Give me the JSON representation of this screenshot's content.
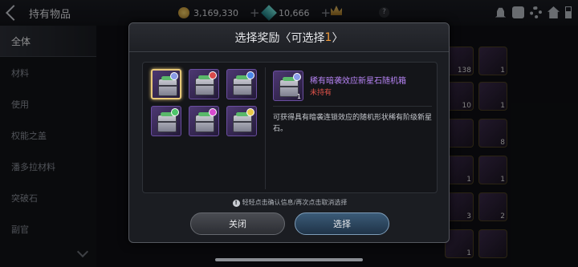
{
  "header": {
    "title": "持有物品",
    "gold": "3,169,330",
    "crystal": "10,666"
  },
  "sidebar": {
    "items": [
      {
        "label": "全体"
      },
      {
        "label": "材料"
      },
      {
        "label": "使用"
      },
      {
        "label": "权能之盖"
      },
      {
        "label": "潘多拉材料"
      },
      {
        "label": "突破石"
      },
      {
        "label": "副官"
      }
    ]
  },
  "background_counts": [
    "138",
    "1",
    "10",
    "1",
    "8",
    "1",
    "1",
    "3",
    "2",
    "1"
  ],
  "modal": {
    "title_main": "选择奖励〈可选择",
    "title_count": "1",
    "title_end": "〉",
    "options": [
      {
        "badge_color": "#8a9be8",
        "selected": true
      },
      {
        "badge_color": "#d84a4a",
        "selected": false
      },
      {
        "badge_color": "#4a86e8",
        "selected": false
      },
      {
        "badge_color": "#4ec46a",
        "selected": false
      },
      {
        "badge_color": "#d84ad0",
        "selected": false
      },
      {
        "badge_color": "#e8c84a",
        "selected": false
      }
    ],
    "detail": {
      "count": "1",
      "name": "稀有暗袭效应新星石随机箱",
      "owned": "未持有",
      "description": "可获得具有暗袭连锁效应的随机形状稀有阶级新星石。"
    },
    "hint": "轻轻点击确认信息/再次点击取消选择",
    "close_label": "关闭",
    "select_label": "选择"
  }
}
